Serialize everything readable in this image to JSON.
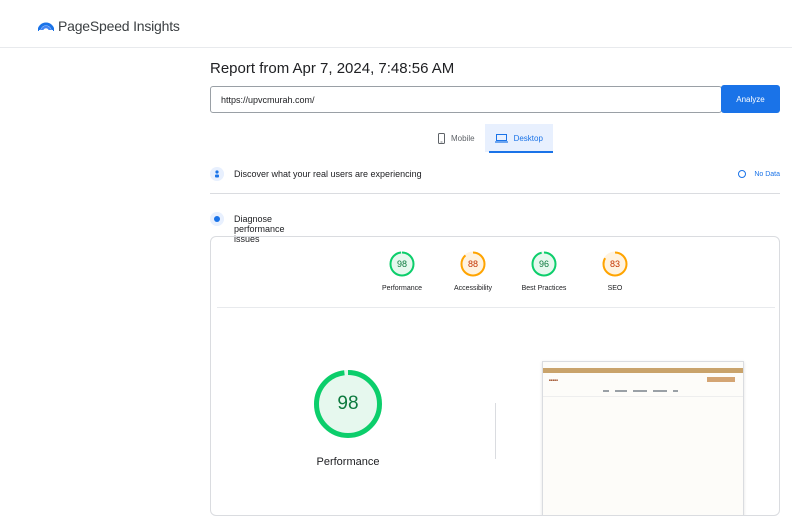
{
  "header": {
    "logo_text": "PageSpeed Insights"
  },
  "report": {
    "title": "Report from Apr 7, 2024, 7:48:56 AM"
  },
  "search": {
    "url_value": "https://upvcmurah.com/",
    "analyze_label": "Analyze"
  },
  "device_tabs": [
    {
      "label": "Mobile",
      "icon": "phone-icon",
      "active": false
    },
    {
      "label": "Desktop",
      "icon": "laptop-icon",
      "active": true
    }
  ],
  "field_data": {
    "title": "Discover what your real users are experiencing",
    "no_data_label": "No Data"
  },
  "diagnose": {
    "title": "Diagnose performance issues"
  },
  "categories": [
    {
      "label": "Performance",
      "score": "98",
      "score_fraction": 0.98,
      "status": "pass"
    },
    {
      "label": "Accessibility",
      "score": "88",
      "score_fraction": 0.88,
      "status": "average"
    },
    {
      "label": "Best Practices",
      "score": "96",
      "score_fraction": 0.96,
      "status": "pass"
    },
    {
      "label": "SEO",
      "score": "83",
      "score_fraction": 0.83,
      "status": "average"
    }
  ],
  "main_gauge": {
    "score": "98",
    "score_fraction": 0.98,
    "label": "Performance"
  },
  "colors": {
    "accent": "#1a73e8",
    "pass_stroke": "#0cce6b",
    "pass_fill": "#e6f8ee",
    "pass_text": "#0c7a3e",
    "average_stroke": "#ffa400",
    "average_fill": "#fff3e0",
    "average_text": "#c33300"
  }
}
